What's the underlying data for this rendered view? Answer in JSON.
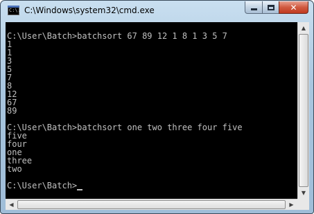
{
  "window": {
    "title": "C:\\Windows\\system32\\cmd.exe",
    "icon_text": "C:\\.",
    "close_glyph": "✕"
  },
  "console": {
    "lines": [
      "",
      "C:\\User\\Batch>batchsort 67 89 12 1 8 1 3 5 7",
      "1",
      "1",
      "3",
      "5",
      "7",
      "8",
      "12",
      "67",
      "89",
      "",
      "C:\\User\\Batch>batchsort one two three four five",
      "five",
      "four",
      "one",
      "three",
      "two",
      "",
      "C:\\User\\Batch>"
    ]
  },
  "scrollbars": {
    "up_arrow": "▲",
    "down_arrow": "▼",
    "left_arrow": "◀",
    "right_arrow": "▶"
  },
  "icons": {
    "app": "console-icon",
    "minimize": "minimize-icon",
    "maximize": "maximize-icon",
    "close": "close-icon"
  }
}
